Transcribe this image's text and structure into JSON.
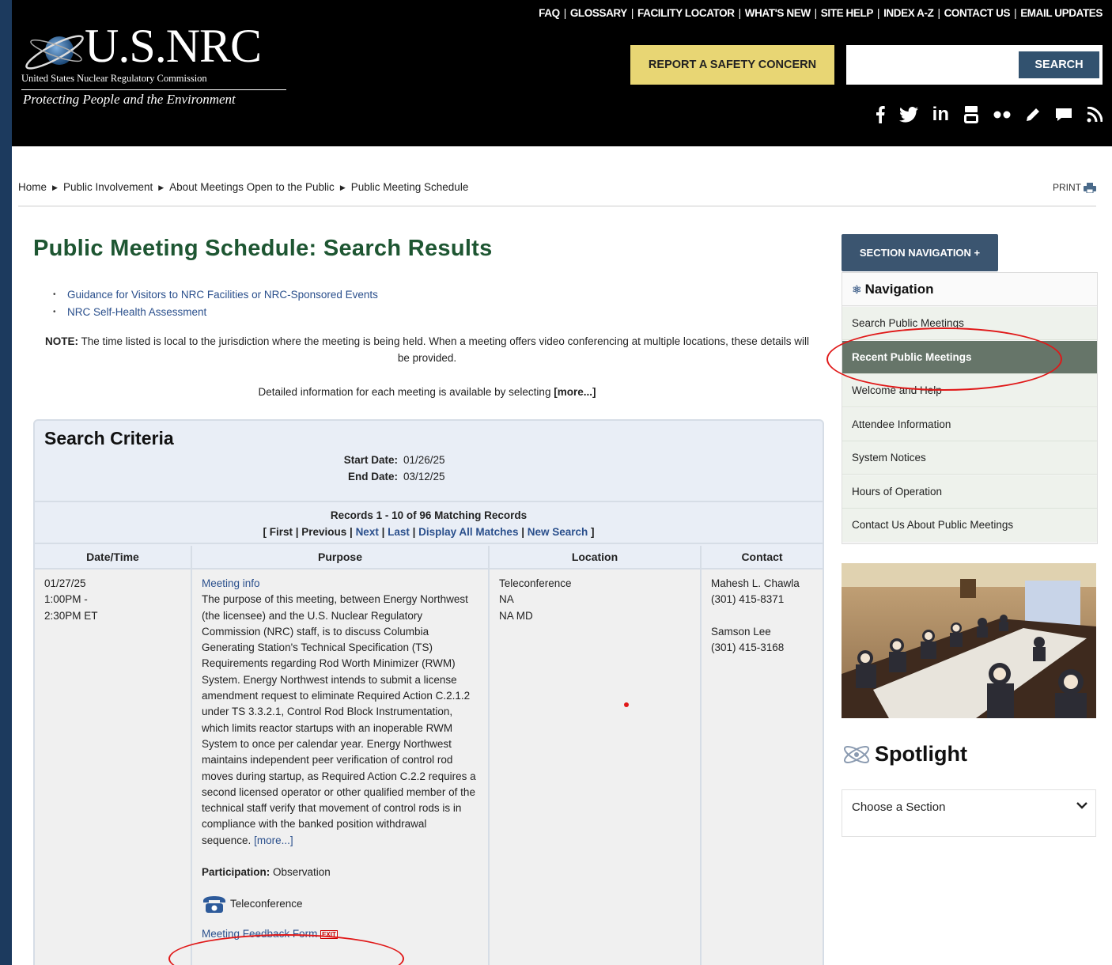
{
  "header": {
    "logo_title": "U.S.NRC",
    "logo_sub": "United States Nuclear Regulatory Commission",
    "logo_tagline": "Protecting People and the Environment",
    "top_links": [
      "FAQ",
      "GLOSSARY",
      "FACILITY LOCATOR",
      "WHAT'S NEW",
      "SITE HELP",
      "INDEX A-Z",
      "CONTACT US",
      "EMAIL UPDATES"
    ],
    "report_label": "REPORT A SAFETY CONCERN",
    "search_value": "",
    "search_label": "SEARCH",
    "social_icons": [
      "facebook-icon",
      "twitter-icon",
      "linkedin-icon",
      "youtube-icon",
      "flickr-icon",
      "blog-icon",
      "chat-icon",
      "rss-icon"
    ]
  },
  "breadcrumb": [
    "Home",
    "Public Involvement",
    "About Meetings Open to the Public",
    "Public Meeting Schedule"
  ],
  "print_label": "PRINT",
  "page_title": "Public Meeting Schedule: Search Results",
  "bullets": [
    "Guidance for Visitors to NRC Facilities or NRC-Sponsored Events",
    "NRC Self-Health Assessment"
  ],
  "note_label": "NOTE:",
  "note_text": "The time listed is local to the jurisdiction where the meeting is being held. When a meeting offers video conferencing at multiple locations, these details will be provided.",
  "detail_text": "Detailed information for each meeting is available by selecting",
  "detail_more": "[more...]",
  "criteria": {
    "heading": "Search Criteria",
    "start_label": "Start Date:",
    "start_value": "01/26/25",
    "end_label": "End Date:",
    "end_value": "03/12/25",
    "records": "Records 1 - 10 of 96 Matching Records",
    "pager": {
      "open": "[",
      "first": "First",
      "previous": "Previous",
      "next": "Next",
      "last": "Last",
      "display_all": "Display All Matches",
      "new_search": "New Search",
      "close": "]"
    }
  },
  "table": {
    "headers": [
      "Date/Time",
      "Purpose",
      "Location",
      "Contact"
    ],
    "row": {
      "date": "01/27/25",
      "time1": "1:00PM -",
      "time2": "2:30PM ET",
      "meeting_info": "Meeting info",
      "purpose": "The purpose of this meeting, between Energy Northwest (the licensee) and the U.S. Nuclear Regulatory Commission (NRC) staff, is to discuss Columbia Generating Station's Technical Specification (TS) Requirements regarding Rod Worth Minimizer (RWM) System. Energy Northwest intends to submit a license amendment request to eliminate Required Action C.2.1.2 under TS 3.3.2.1, Control Rod Block Instrumentation, which limits reactor startups with an inoperable RWM System to once per calendar year. Energy Northwest maintains independent peer verification of control rod moves during startup, as Required Action C.2.2 requires a second licensed operator or other qualified member of the technical staff verify that movement of control rods is in compliance with the banked position withdrawal sequence.",
      "purpose_more": "[more...]",
      "participation_label": "Participation:",
      "participation_value": "Observation",
      "teleconference": "Teleconference",
      "feedback": "Meeting Feedback Form",
      "exit_badge": "EXIT",
      "location": [
        "Teleconference",
        "NA",
        "NA MD"
      ],
      "contacts": [
        {
          "name": "Mahesh L. Chawla",
          "phone": "(301) 415-8371"
        },
        {
          "name": "Samson Lee",
          "phone": "(301) 415-3168"
        }
      ]
    }
  },
  "sidebar": {
    "section_nav": "SECTION NAVIGATION +",
    "nav_heading": "Navigation",
    "items": [
      "Search Public Meetings",
      "Recent Public Meetings",
      "Welcome and Help",
      "Attendee Information",
      "System Notices",
      "Hours of Operation",
      "Contact Us About Public Meetings"
    ],
    "active_index": 1,
    "spotlight": "Spotlight",
    "choose": "Choose a Section"
  },
  "colors": {
    "header_bg": "#000000",
    "title_green": "#1e5632",
    "link_blue": "#2a4f8c",
    "report_yellow": "#e8d674",
    "annotation_red": "#e01818",
    "active_nav": "#667569"
  }
}
